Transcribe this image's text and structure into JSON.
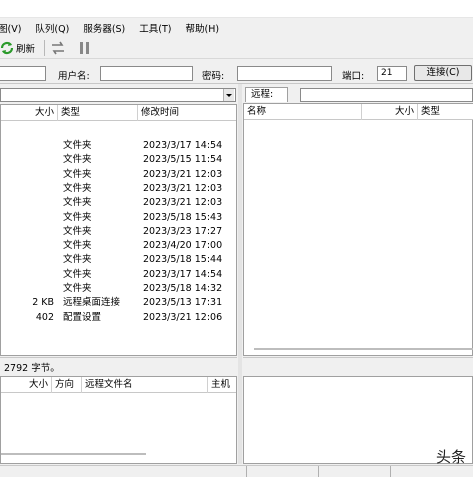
{
  "menu": [
    "图(V)",
    "队列(Q)",
    "服务器(S)",
    "工具(T)",
    "帮助(H)"
  ],
  "toolbar": {
    "refresh_label": "刷新"
  },
  "connect": {
    "username_label": "用户名:",
    "password_label": "密码:",
    "port_label": "端口:",
    "port_value": "21",
    "connect_button": "连接(C)"
  },
  "local": {
    "columns": {
      "size": "大小",
      "type": "类型",
      "modified": "修改时间"
    },
    "files": [
      {
        "size": "",
        "type": "文件夹",
        "modified": "2023/3/17 14:54"
      },
      {
        "size": "",
        "type": "文件夹",
        "modified": "2023/5/15 11:54"
      },
      {
        "size": "",
        "type": "文件夹",
        "modified": "2023/3/21 12:03"
      },
      {
        "size": "",
        "type": "文件夹",
        "modified": "2023/3/21 12:03"
      },
      {
        "size": "",
        "type": "文件夹",
        "modified": "2023/3/21 12:03"
      },
      {
        "size": "",
        "type": "文件夹",
        "modified": "2023/5/18 15:43"
      },
      {
        "size": "",
        "type": "文件夹",
        "modified": "2023/3/23 17:27"
      },
      {
        "size": "",
        "type": "文件夹",
        "modified": "2023/4/20 17:00"
      },
      {
        "size": "",
        "type": "文件夹",
        "modified": "2023/5/18 15:44"
      },
      {
        "size": "",
        "type": "文件夹",
        "modified": "2023/3/17 14:54"
      },
      {
        "size": "",
        "type": "文件夹",
        "modified": "2023/5/18 14:32"
      },
      {
        "size": "2 KB",
        "type": "远程桌面连接",
        "modified": "2023/5/13 17:31"
      },
      {
        "size": "402",
        "type": "配置设置",
        "modified": "2023/3/21 12:06"
      }
    ],
    "status": "2792 字节。"
  },
  "remote": {
    "tab_label": "远程:",
    "columns": {
      "name": "名称",
      "size": "大小",
      "type": "类型"
    }
  },
  "queue": {
    "columns": {
      "size": "大小",
      "direction": "方向",
      "remote_file": "远程文件名",
      "host": "主机"
    }
  },
  "watermark": "头条"
}
